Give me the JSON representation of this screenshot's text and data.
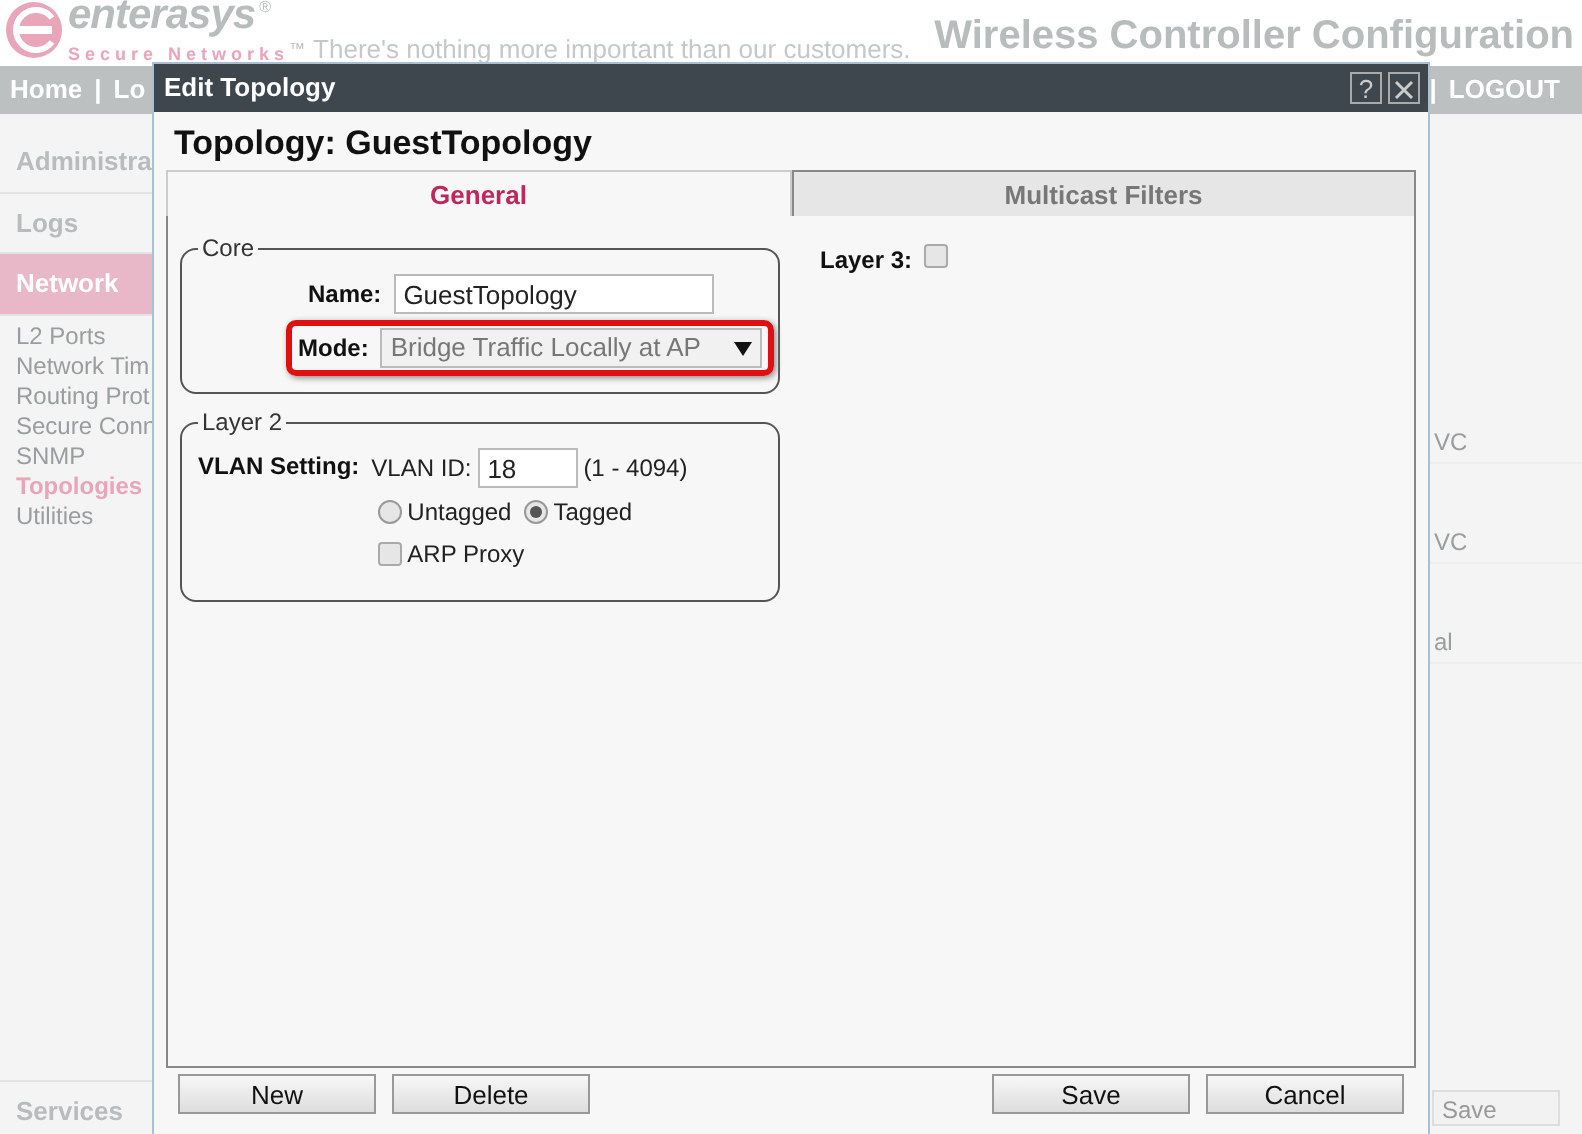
{
  "header": {
    "brand": "enterasys",
    "brand_mark": "®",
    "tagline": "Secure Networks",
    "tagline_mark": "™",
    "slogan": "There's nothing more important than our customers.",
    "app_title": "Wireless Controller Configuration"
  },
  "top_nav": {
    "left": [
      "Home",
      "|",
      "Lo"
    ],
    "right": [
      "|",
      "LOGOUT"
    ]
  },
  "sidebar": {
    "sections": [
      {
        "label": "Administra",
        "selected": false
      },
      {
        "label": "Logs",
        "selected": false
      },
      {
        "label": "Network",
        "selected": true
      }
    ],
    "items": [
      {
        "label": "L2 Ports",
        "selected": false
      },
      {
        "label": "Network Tim",
        "selected": false
      },
      {
        "label": "Routing Prot",
        "selected": false
      },
      {
        "label": "Secure Conn",
        "selected": false
      },
      {
        "label": "SNMP",
        "selected": false
      },
      {
        "label": "Topologies",
        "selected": true
      },
      {
        "label": "Utilities",
        "selected": false
      }
    ],
    "footer": "Services"
  },
  "background_panel": {
    "cells": [
      "VC",
      "VC",
      "al"
    ],
    "button": "Save"
  },
  "dialog": {
    "title": "Edit Topology",
    "help": "?",
    "heading": "Topology: GuestTopology",
    "tabs": [
      {
        "label": "General",
        "selected": true
      },
      {
        "label": "Multicast Filters",
        "selected": false
      }
    ],
    "core": {
      "legend": "Core",
      "name_label": "Name:",
      "name_value": "GuestTopology",
      "mode_label": "Mode:",
      "mode_value": "Bridge Traffic Locally at AP",
      "highlighted": true
    },
    "layer2": {
      "legend": "Layer 2",
      "vlan_label": "VLAN Setting:",
      "vlan_id_label": "VLAN ID:",
      "vlan_id": "18",
      "range": "(1 - 4094)",
      "tagging": [
        {
          "label": "Untagged",
          "selected": false
        },
        {
          "label": "Tagged",
          "selected": true
        }
      ],
      "arp_proxy": {
        "label": "ARP Proxy",
        "checked": false
      }
    },
    "layer3": {
      "label": "Layer 3:",
      "checked": false
    },
    "buttons_left": [
      "New",
      "Delete"
    ],
    "buttons_right": [
      "Save",
      "Cancel"
    ]
  }
}
